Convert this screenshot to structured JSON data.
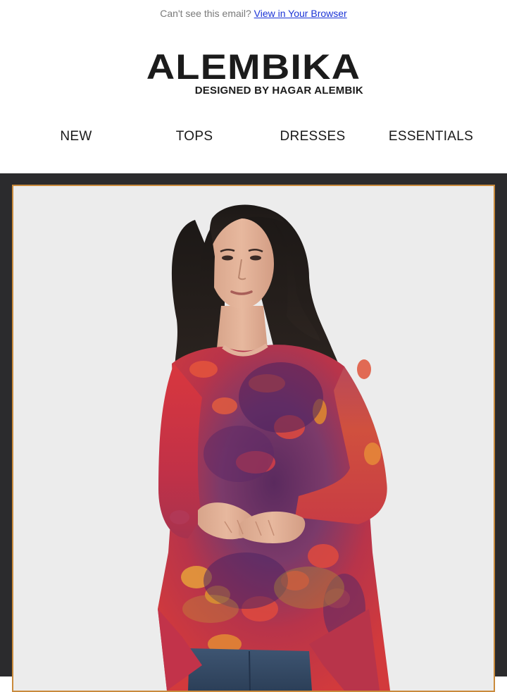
{
  "preheader": {
    "text": "Can't see this email?",
    "link_label": "View in Your Browser"
  },
  "brand": {
    "name": "ALEMBIKA",
    "tagline": "DESIGNED BY HAGAR ALEMBIK"
  },
  "nav": {
    "items": [
      {
        "label": "NEW"
      },
      {
        "label": "TOPS"
      },
      {
        "label": "DRESSES"
      },
      {
        "label": "ESSENTIALS"
      }
    ]
  },
  "hero": {
    "image_subject": "model-wearing-tie-dye-tunic",
    "colors": {
      "frame": "#2b2b2d",
      "border": "#c98a3c",
      "backdrop": "#ececec"
    }
  },
  "theme": {
    "text": "#1b1b1b",
    "link": "#1a33d6",
    "muted": "#7a7a7a"
  }
}
